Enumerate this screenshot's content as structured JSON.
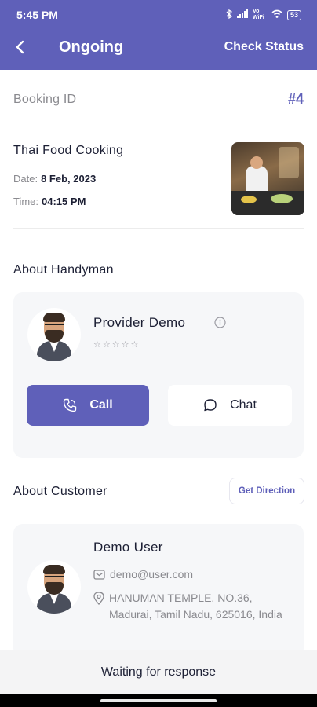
{
  "status_bar": {
    "time": "5:45 PM",
    "network": "Vo WiFi",
    "battery": "53"
  },
  "header": {
    "title": "Ongoing",
    "action_label": "Check Status",
    "background": "#5f60b9"
  },
  "booking": {
    "id_label": "Booking ID",
    "id_value": "#4"
  },
  "service": {
    "name": "Thai Food Cooking",
    "date_label": "Date:",
    "date_value": "8 Feb, 2023",
    "time_label": "Time:",
    "time_value": "04:15 PM"
  },
  "handyman": {
    "section_title": "About Handyman",
    "name": "Provider Demo",
    "rating_stars": "☆☆☆☆☆",
    "call_label": "Call",
    "chat_label": "Chat"
  },
  "customer": {
    "section_title": "About Customer",
    "direction_label": "Get Direction",
    "name": "Demo User",
    "email": "demo@user.com",
    "address": "HANUMAN TEMPLE, NO.36, Madurai, Tamil Nadu, 625016, India"
  },
  "footer": {
    "status_text": "Waiting for response"
  },
  "colors": {
    "accent": "#5f60b9",
    "card_bg": "#f6f7f9",
    "muted_text": "#8a8a8f"
  }
}
